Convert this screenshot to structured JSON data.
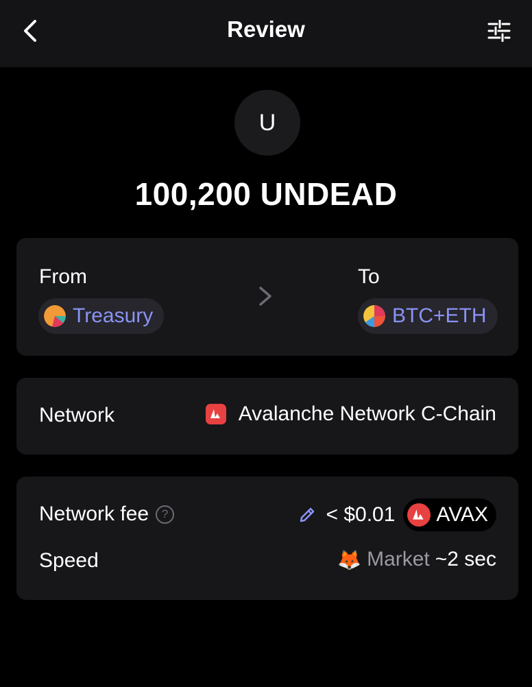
{
  "header": {
    "title": "Review"
  },
  "token": {
    "avatar_letter": "U",
    "amount_label": "100,200 UNDEAD"
  },
  "transfer": {
    "from_label": "From",
    "from_account": "Treasury",
    "to_label": "To",
    "to_account": "BTC+ETH"
  },
  "network": {
    "label": "Network",
    "value": "Avalanche Network C-Chain"
  },
  "fee": {
    "label": "Network fee",
    "help_glyph": "?",
    "amount": "< $0.01",
    "token": "AVAX"
  },
  "speed": {
    "label": "Speed",
    "emoji": "🦊",
    "name": "Market",
    "time": "~2 sec"
  },
  "colors": {
    "accent": "#8b93f5",
    "avax_red": "#e84142",
    "card_bg": "#17171a",
    "header_bg": "#141416"
  }
}
